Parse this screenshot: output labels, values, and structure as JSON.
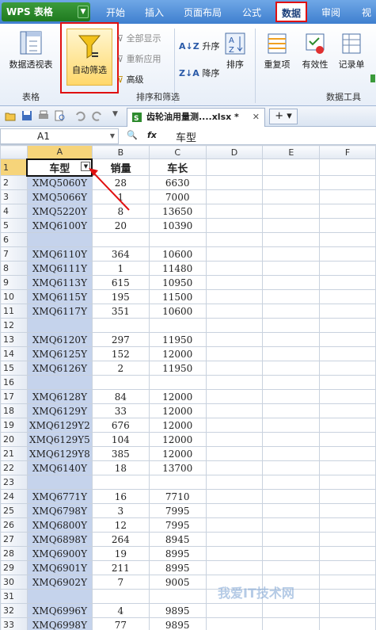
{
  "app": {
    "logo": "WPS 表格"
  },
  "ribbon_tabs": [
    "开始",
    "插入",
    "页面布局",
    "公式",
    "数据",
    "审阅",
    "视"
  ],
  "ribbon": {
    "pivot_label": "数据透视表",
    "autofilter_label": "自动筛选",
    "show_all": "全部显示",
    "reapply": "重新应用",
    "advanced": "高级",
    "sort_asc": "升序",
    "sort_desc": "降序",
    "sort": "排序",
    "duplicates": "重复项",
    "validity": "有效性",
    "record": "记录单",
    "group_table": "表格",
    "group_sort_filter": "排序和筛选",
    "group_data_tools": "数据工具"
  },
  "document_tab": {
    "name": "齿轮油用量测....xlsx *"
  },
  "formula_bar": {
    "cell_ref": "A1",
    "fx": "fx",
    "value": "车型"
  },
  "columns": [
    "A",
    "B",
    "C",
    "D",
    "E",
    "F"
  ],
  "header_row": {
    "a": "车型",
    "b": "销量",
    "c": "车长"
  },
  "rows": [
    {
      "n": "2",
      "a": "XMQ5060Y",
      "b": "28",
      "c": "6630"
    },
    {
      "n": "3",
      "a": "XMQ5066Y",
      "b": "1",
      "c": "7000"
    },
    {
      "n": "4",
      "a": "XMQ5220Y",
      "b": "8",
      "c": "13650"
    },
    {
      "n": "5",
      "a": "XMQ6100Y",
      "b": "20",
      "c": "10390"
    },
    {
      "n": "6",
      "a": "",
      "b": "",
      "c": ""
    },
    {
      "n": "7",
      "a": "XMQ6110Y",
      "b": "364",
      "c": "10600"
    },
    {
      "n": "8",
      "a": "XMQ6111Y",
      "b": "1",
      "c": "11480"
    },
    {
      "n": "9",
      "a": "XMQ6113Y",
      "b": "615",
      "c": "10950"
    },
    {
      "n": "10",
      "a": "XMQ6115Y",
      "b": "195",
      "c": "11500"
    },
    {
      "n": "11",
      "a": "XMQ6117Y",
      "b": "351",
      "c": "10600"
    },
    {
      "n": "12",
      "a": "",
      "b": "",
      "c": ""
    },
    {
      "n": "13",
      "a": "XMQ6120Y",
      "b": "297",
      "c": "11950"
    },
    {
      "n": "14",
      "a": "XMQ6125Y",
      "b": "152",
      "c": "12000"
    },
    {
      "n": "15",
      "a": "XMQ6126Y",
      "b": "2",
      "c": "11950"
    },
    {
      "n": "16",
      "a": "",
      "b": "",
      "c": ""
    },
    {
      "n": "17",
      "a": "XMQ6128Y",
      "b": "84",
      "c": "12000"
    },
    {
      "n": "18",
      "a": "XMQ6129Y",
      "b": "33",
      "c": "12000"
    },
    {
      "n": "19",
      "a": "XMQ6129Y2",
      "b": "676",
      "c": "12000"
    },
    {
      "n": "20",
      "a": "XMQ6129Y5",
      "b": "104",
      "c": "12000"
    },
    {
      "n": "21",
      "a": "XMQ6129Y8",
      "b": "385",
      "c": "12000"
    },
    {
      "n": "22",
      "a": "XMQ6140Y",
      "b": "18",
      "c": "13700"
    },
    {
      "n": "23",
      "a": "",
      "b": "",
      "c": ""
    },
    {
      "n": "24",
      "a": "XMQ6771Y",
      "b": "16",
      "c": "7710"
    },
    {
      "n": "25",
      "a": "XMQ6798Y",
      "b": "3",
      "c": "7995"
    },
    {
      "n": "26",
      "a": "XMQ6800Y",
      "b": "12",
      "c": "7995"
    },
    {
      "n": "27",
      "a": "XMQ6898Y",
      "b": "264",
      "c": "8945"
    },
    {
      "n": "28",
      "a": "XMQ6900Y",
      "b": "19",
      "c": "8995"
    },
    {
      "n": "29",
      "a": "XMQ6901Y",
      "b": "211",
      "c": "8995"
    },
    {
      "n": "30",
      "a": "XMQ6902Y",
      "b": "7",
      "c": "9005"
    },
    {
      "n": "31",
      "a": "",
      "b": "",
      "c": ""
    },
    {
      "n": "32",
      "a": "XMQ6996Y",
      "b": "4",
      "c": "9895"
    },
    {
      "n": "33",
      "a": "XMQ6998Y",
      "b": "77",
      "c": "9895"
    }
  ],
  "watermark": "我爱IT技术网"
}
